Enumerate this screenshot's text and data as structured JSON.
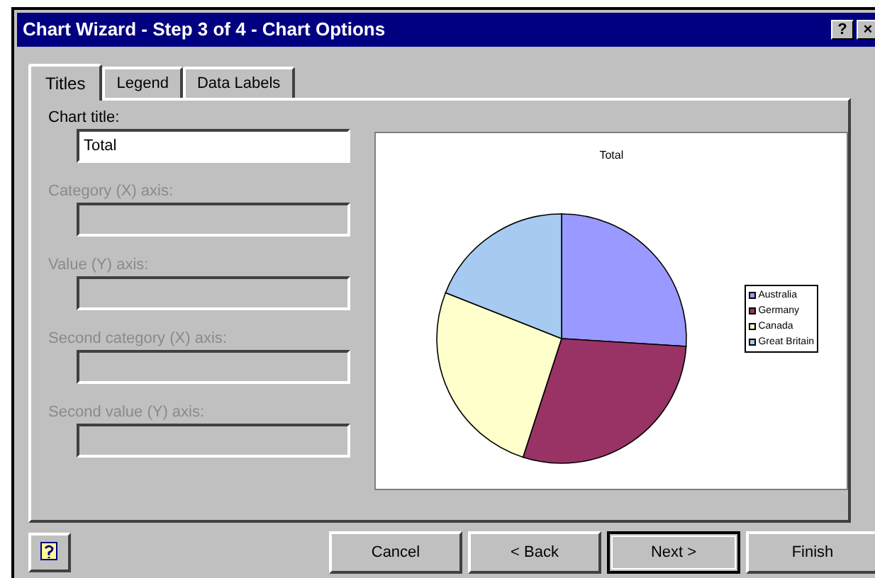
{
  "window": {
    "title": "Chart Wizard - Step 3 of 4 - Chart Options"
  },
  "title_buttons": [
    {
      "label": "?"
    },
    {
      "label": "×"
    }
  ],
  "tabs": [
    {
      "label": "Titles",
      "selected": true
    },
    {
      "label": "Legend",
      "selected": false
    },
    {
      "label": "Data Labels",
      "selected": false
    }
  ],
  "fields": [
    {
      "label": "Chart title:",
      "value": "Total",
      "disabled": false
    },
    {
      "label": "Category (X) axis:",
      "disabled": true
    },
    {
      "label": "Value (Y) axis:",
      "disabled": true
    },
    {
      "label": "Second category (X) axis:",
      "disabled": true
    },
    {
      "label": "Second value (Y) axis:",
      "disabled": true
    }
  ],
  "preview": {
    "title": "Total",
    "legend": [
      {
        "label": "Australia",
        "color": "#9999ff"
      },
      {
        "label": "Germany",
        "color": "#993366"
      },
      {
        "label": "Canada",
        "color": "#ffffcc"
      },
      {
        "label": "Great Britain",
        "color": "#a6caf0"
      }
    ]
  },
  "buttons": [
    {
      "label": "Cancel",
      "default": false
    },
    {
      "label": "< Back",
      "default": false
    },
    {
      "label": "Next >",
      "default": true
    },
    {
      "label": "Finish",
      "default": false
    }
  ]
}
